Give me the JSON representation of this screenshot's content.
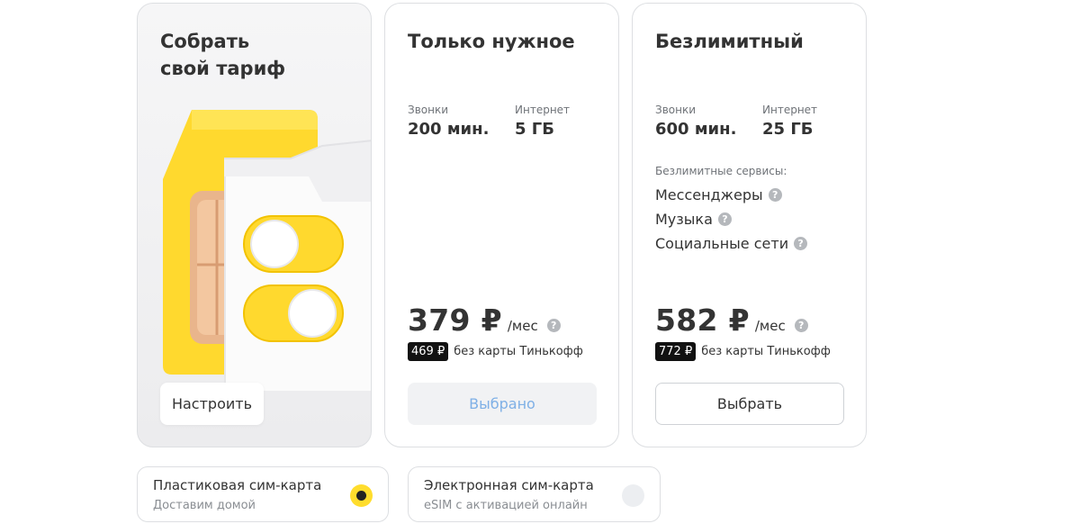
{
  "custom_card": {
    "title": "Собрать\nсвой тариф",
    "button_label": "Настроить"
  },
  "tariffs": [
    {
      "title": "Только нужное",
      "calls_label": "Звонки",
      "calls_value": "200 мин.",
      "internet_label": "Интернет",
      "internet_value": "5 ГБ",
      "price": "379 ₽",
      "per": "/мес",
      "old_price": "469 ₽",
      "old_note": "без карты Тинькофф",
      "button_label": "Выбрано"
    },
    {
      "title": "Безлимитный",
      "calls_label": "Звонки",
      "calls_value": "600 мин.",
      "internet_label": "Интернет",
      "internet_value": "25 ГБ",
      "services_title": "Безлимитные сервисы:",
      "services": [
        "Мессенджеры",
        "Музыка",
        "Социальные сети"
      ],
      "price": "582 ₽",
      "per": "/мес",
      "old_price": "772 ₽",
      "old_note": "без карты Тинькофф",
      "button_label": "Выбрать"
    }
  ],
  "sim_options": [
    {
      "title": "Пластиковая сим-карта",
      "subtitle": "Доставим домой",
      "selected": true
    },
    {
      "title": "Электронная сим-карта",
      "subtitle": "eSIM с активацией онлайн",
      "selected": false
    }
  ],
  "help_glyph": "?",
  "colors": {
    "accent_yellow": "#ffdd2d",
    "selected_button_text": "#7fb0e6",
    "old_price_bg": "#111111"
  }
}
